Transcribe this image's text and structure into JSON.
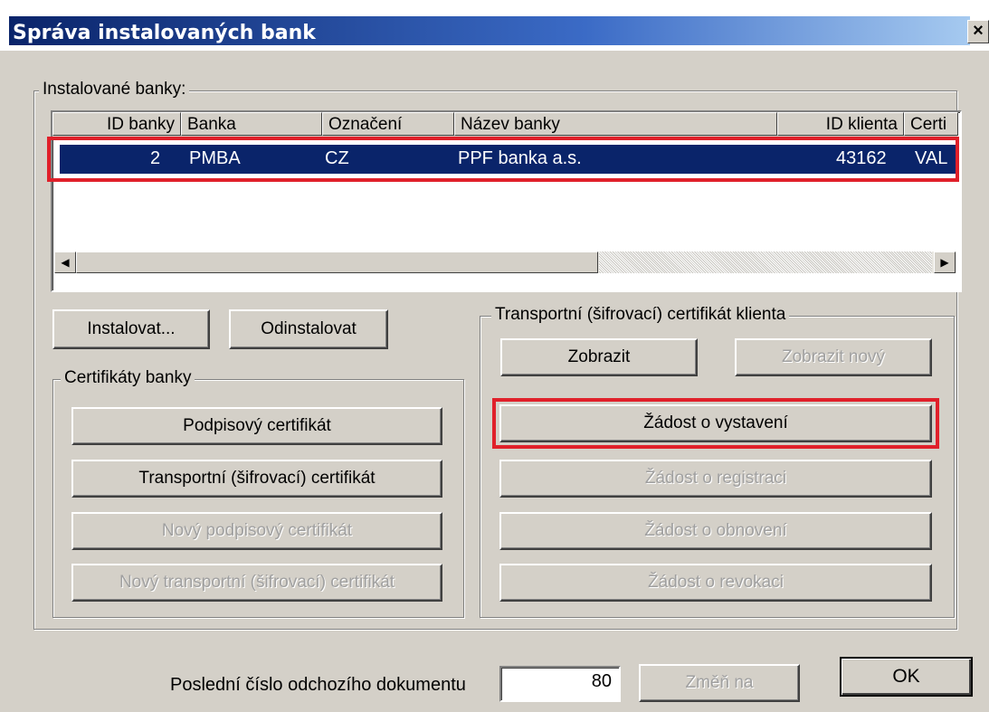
{
  "window": {
    "title": "Správa instalovaných bank",
    "close_glyph": "×"
  },
  "installed": {
    "label": "Instalované banky:",
    "columns": [
      "ID banky",
      "Banka",
      "Označení",
      "Název banky",
      "ID klienta",
      "Certi"
    ],
    "rows": [
      {
        "id": "2",
        "bank": "PMBA",
        "mark": "CZ",
        "name": "PPF banka a.s.",
        "client_id": "43162",
        "cert": "VAL"
      }
    ]
  },
  "buttons": {
    "install": "Instalovat...",
    "uninstall": "Odinstalovat"
  },
  "bank_certs": {
    "label": "Certifikáty banky",
    "sign": "Podpisový certifikát",
    "transport": "Transportní (šifrovací) certifikát",
    "new_sign": "Nový podpisový certifikát",
    "new_transport": "Nový transportní (šifrovací) certifikát"
  },
  "client_cert": {
    "label": "Transportní (šifrovací) certifikát klienta",
    "show": "Zobrazit",
    "show_new": "Zobrazit nový",
    "request_issue": "Žádost o vystavení",
    "request_register": "Žádost o registraci",
    "request_renew": "Žádost o obnovení",
    "request_revoke": "Žádost o revokaci"
  },
  "footer": {
    "last_doc_label": "Poslední číslo odchozího dokumentu",
    "last_doc_value": "80",
    "change_to": "Změň na",
    "ok": "OK"
  },
  "colors": {
    "highlight": "#e0202a",
    "selection": "#0a246a",
    "face": "#d4d0c8"
  }
}
